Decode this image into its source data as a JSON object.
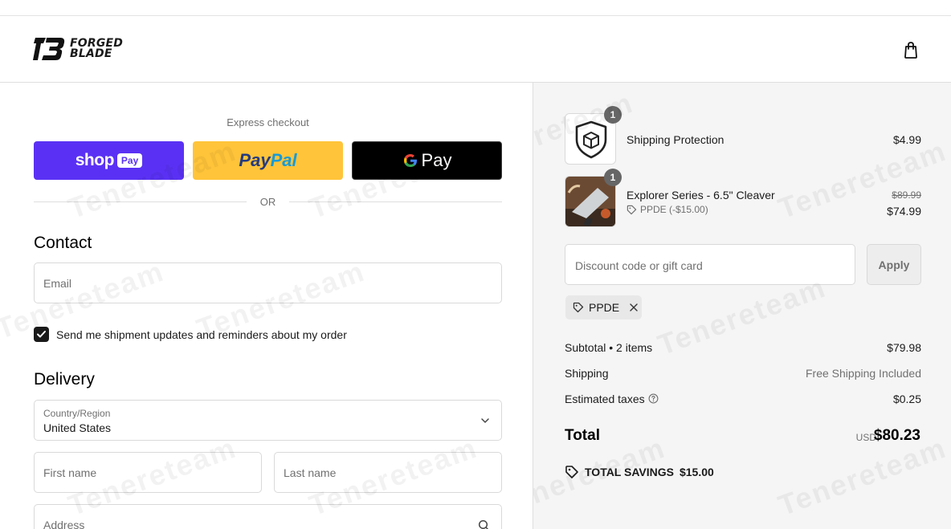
{
  "brand": {
    "line1": "FORGED",
    "line2": "BLADE"
  },
  "header": {
    "cart_icon": "shopping-bag-icon"
  },
  "express": {
    "label": "Express checkout",
    "shop_pay": "shop",
    "shop_pay_badge": "Pay",
    "paypal_a": "Pay",
    "paypal_b": "Pal",
    "gpay": "Pay"
  },
  "or_text": "OR",
  "contact": {
    "heading": "Contact",
    "email_placeholder": "Email",
    "marketing_checked": true,
    "marketing_label": "Send me shipment updates and reminders about my order"
  },
  "delivery": {
    "heading": "Delivery",
    "country_label": "Country/Region",
    "country_value": "United States",
    "first_name_placeholder": "First name",
    "last_name_placeholder": "Last name",
    "address_placeholder": "Address"
  },
  "cart": {
    "items": [
      {
        "name": "Shipping Protection",
        "price": "$4.99",
        "quantity": "1"
      },
      {
        "name": "Explorer Series - 6.5\" Cleaver",
        "compare_price": "$89.99",
        "price": "$74.99",
        "quantity": "1",
        "discount": "PPDE (-$15.00)"
      }
    ]
  },
  "discount": {
    "placeholder": "Discount code or gift card",
    "apply_label": "Apply",
    "applied_code": "PPDE"
  },
  "summary": {
    "subtotal_label": "Subtotal • 2 items",
    "subtotal_value": "$79.98",
    "shipping_label": "Shipping",
    "shipping_value": "Free Shipping Included",
    "taxes_label": "Estimated taxes",
    "taxes_value": "$0.25",
    "total_label": "Total",
    "currency": "USD",
    "total_value": "$80.23",
    "savings_label": "TOTAL SAVINGS",
    "savings_value": "$15.00"
  },
  "watermark": "Tenereteam",
  "colors": {
    "shop_pay": "#5a31f4",
    "paypal": "#ffc439",
    "gpay": "#000000",
    "summary_bg": "#f5f5f5"
  }
}
